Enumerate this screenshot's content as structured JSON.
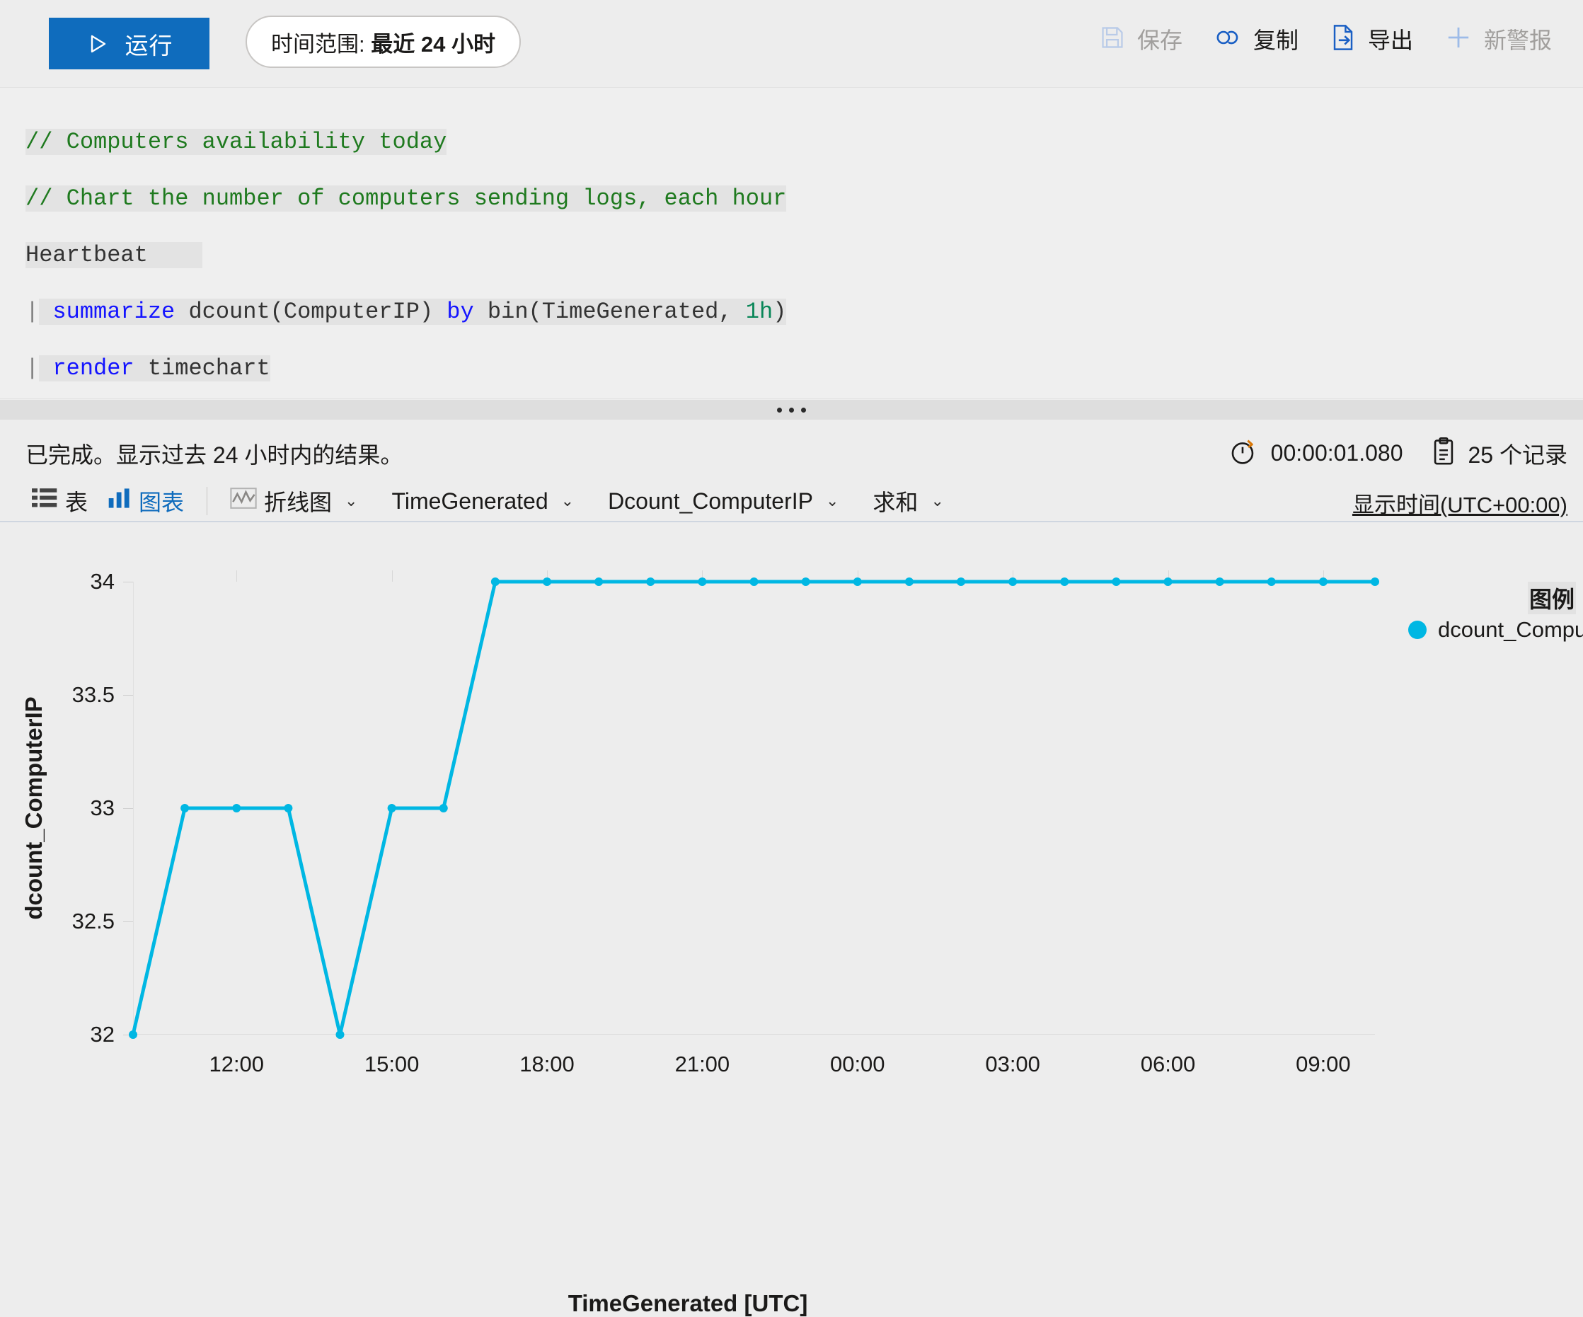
{
  "toolbar": {
    "run_label": "运行",
    "run_icon": "play-icon",
    "time_range_prefix": "时间范围: ",
    "time_range_value": "最近 24 小时",
    "actions": [
      {
        "label": "保存",
        "icon": "save-icon",
        "name": "save-button",
        "disabled": true
      },
      {
        "label": "复制",
        "icon": "copy-link-icon",
        "name": "copy-button",
        "disabled": false
      },
      {
        "label": "导出",
        "icon": "export-icon",
        "name": "export-button",
        "disabled": false
      },
      {
        "label": "新警报",
        "icon": "plus-icon",
        "name": "new-alert-button",
        "disabled": true
      }
    ]
  },
  "editor": {
    "lines": [
      {
        "text": "// Computers availability today",
        "kind": "comment"
      },
      {
        "text": "// Chart the number of computers sending logs, each hour",
        "kind": "comment"
      },
      {
        "text": "Heartbeat",
        "kind": "table"
      },
      {
        "text": "| summarize dcount(ComputerIP) by bin(TimeGenerated, 1h)",
        "kind": "pipe-summarize"
      },
      {
        "text": "| render timechart",
        "kind": "pipe-render"
      }
    ],
    "tokens": {
      "comment1": "// Computers availability today",
      "comment2": "// Chart the number of computers sending logs, each hour",
      "table": "Heartbeat",
      "pipe": "|",
      "kw_summarize": "summarize",
      "expr_dcount": " dcount(ComputerIP) ",
      "kw_by": "by",
      "expr_bin_open": " bin(TimeGenerated, ",
      "timespan": "1h",
      "expr_bin_close": ")",
      "kw_render": "render",
      "render_target": " timechart"
    }
  },
  "results": {
    "status": "已完成。显示过去 24 小时内的结果。",
    "duration_icon": "stopwatch-icon",
    "duration": "00:00:01.080",
    "records_icon": "clipboard-icon",
    "records": "25 个记录",
    "timezone": "显示时间(UTC+00:00)",
    "view_tabs": [
      {
        "label": "表",
        "icon": "table-icon",
        "name": "tab-table",
        "selected": false
      },
      {
        "label": "图表",
        "icon": "bar-chart-icon",
        "name": "tab-chart",
        "selected": true
      }
    ],
    "chart_controls": [
      {
        "label": "折线图",
        "icon": "line-chart-icon",
        "name": "chart-type-select",
        "caret": "⌄",
        "dim": true
      },
      {
        "label": "TimeGenerated",
        "icon": "",
        "name": "x-axis-select",
        "caret": "⌄",
        "dim": false
      },
      {
        "label": "Dcount_ComputerIP",
        "icon": "",
        "name": "y-axis-select",
        "caret": "⌄",
        "dim": false
      },
      {
        "label": "求和",
        "icon": "",
        "name": "aggregation-select",
        "caret": "⌄",
        "dim": false
      }
    ]
  },
  "chart_data": {
    "type": "line",
    "title": "",
    "xlabel": "TimeGenerated [UTC]",
    "ylabel": "dcount_ComputerIP",
    "ylim": [
      32,
      34
    ],
    "yticks": [
      32,
      32.5,
      33,
      33.5,
      34
    ],
    "ytick_labels": [
      "32",
      "32.5",
      "33",
      "33.5",
      "34"
    ],
    "xticks": [
      "12:00",
      "15:00",
      "18:00",
      "21:00",
      "00:00",
      "03:00",
      "06:00",
      "09:00"
    ],
    "xtick_hours": [
      12,
      15,
      18,
      21,
      24,
      27,
      30,
      33
    ],
    "x_range_hours": [
      10,
      34
    ],
    "grid": false,
    "legend_position": "right",
    "legend_title": "图例",
    "series": [
      {
        "name": "dcount_Computer",
        "color": "#00b7e3",
        "x": [
          "10:00",
          "11:00",
          "12:00",
          "13:00",
          "14:00",
          "15:00",
          "16:00",
          "17:00",
          "18:00",
          "19:00",
          "20:00",
          "21:00",
          "22:00",
          "23:00",
          "00:00",
          "01:00",
          "02:00",
          "03:00",
          "04:00",
          "05:00",
          "06:00",
          "07:00",
          "08:00",
          "09:00",
          "10:00"
        ],
        "values": [
          32,
          33,
          33,
          33,
          32,
          33,
          33,
          34,
          34,
          34,
          34,
          34,
          34,
          34,
          34,
          34,
          34,
          34,
          34,
          34,
          34,
          34,
          34,
          34,
          34
        ]
      }
    ]
  },
  "colors": {
    "accent": "#0f6cbd",
    "series": "#00b7e3",
    "background": "#ededed",
    "disabled_text": "#a19f9d"
  }
}
